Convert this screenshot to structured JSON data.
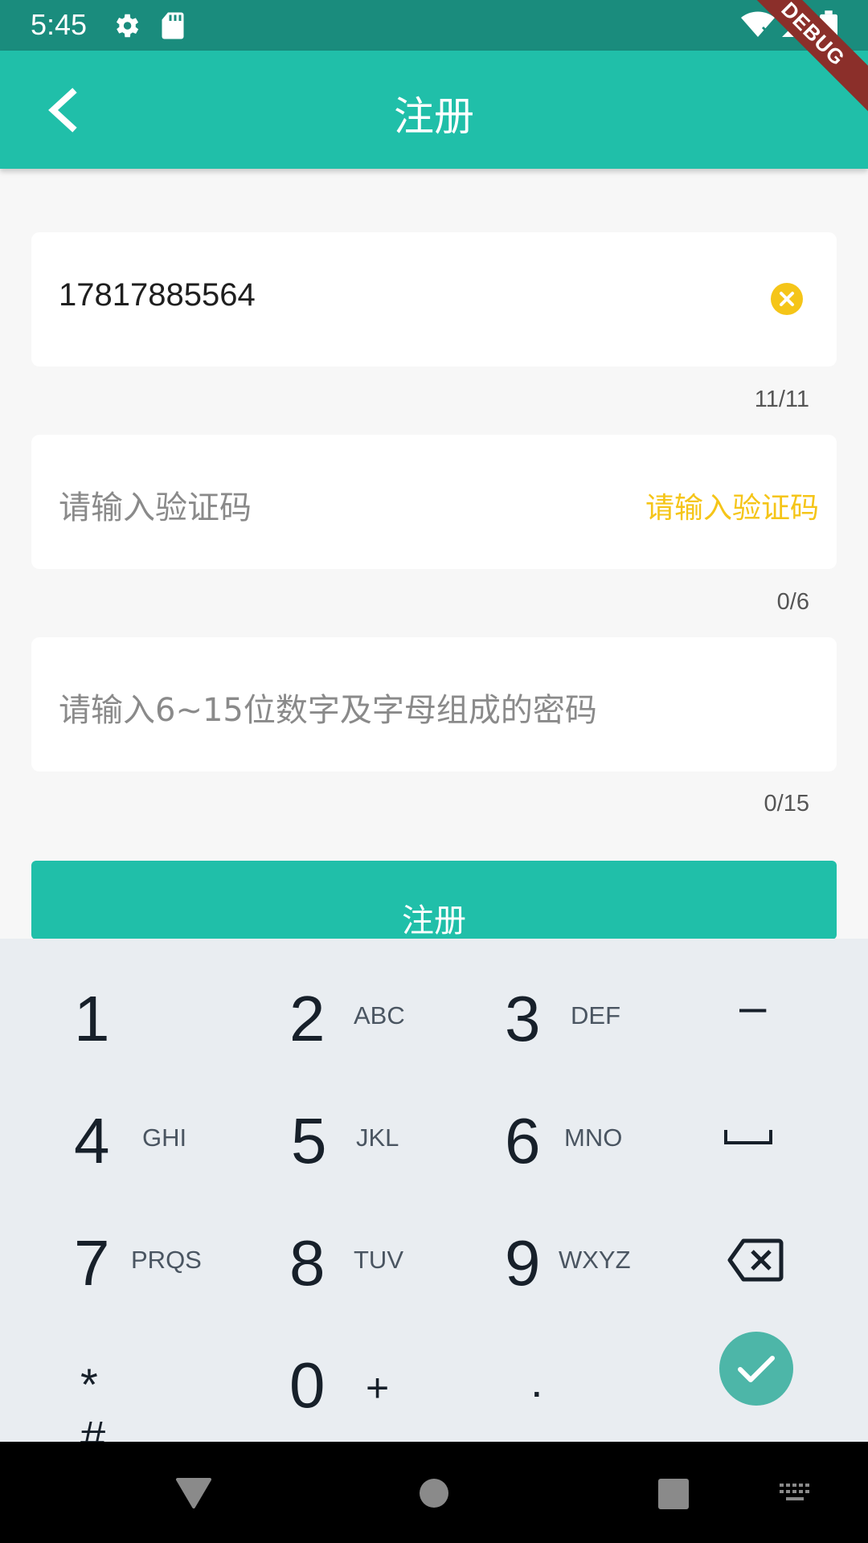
{
  "status_bar": {
    "time": "5:45",
    "icons": [
      "gear-icon",
      "sd-card-icon",
      "wifi-icon",
      "signal-icon",
      "battery-icon"
    ],
    "background": "#1a8c7d"
  },
  "debug_ribbon": "DEBUG",
  "app_bar": {
    "title": "注册",
    "back_icon": "chevron-left-icon",
    "background": "#20bfa9"
  },
  "form": {
    "phone": {
      "value": "17817885564",
      "counter": "11/11",
      "clear_icon": "clear-circle-icon"
    },
    "code": {
      "placeholder": "请输入验证码",
      "action_label": "请输入验证码",
      "counter": "0/6"
    },
    "password": {
      "placeholder": "请输入6~15位数字及字母组成的密码",
      "counter": "0/15"
    },
    "submit_label": "注册"
  },
  "keyboard": {
    "rows": [
      [
        {
          "num": "1",
          "letters": ""
        },
        {
          "num": "2",
          "letters": "ABC"
        },
        {
          "num": "3",
          "letters": "DEF"
        },
        {
          "symbol": "–"
        }
      ],
      [
        {
          "num": "4",
          "letters": "GHI"
        },
        {
          "num": "5",
          "letters": "JKL"
        },
        {
          "num": "6",
          "letters": "MNO"
        },
        {
          "icon": "space-icon"
        }
      ],
      [
        {
          "num": "7",
          "letters": "PRQS"
        },
        {
          "num": "8",
          "letters": "TUV"
        },
        {
          "num": "9",
          "letters": "WXYZ"
        },
        {
          "icon": "backspace-icon"
        }
      ],
      [
        {
          "symbol": "* #"
        },
        {
          "num": "0",
          "letters": "+"
        },
        {
          "symbol": "."
        },
        {
          "icon": "check-icon"
        }
      ]
    ],
    "accent": "#4db6a8"
  },
  "nav_bar": {
    "icons": [
      "back-triangle-icon",
      "home-circle-icon",
      "recents-square-icon",
      "keyboard-icon"
    ]
  }
}
